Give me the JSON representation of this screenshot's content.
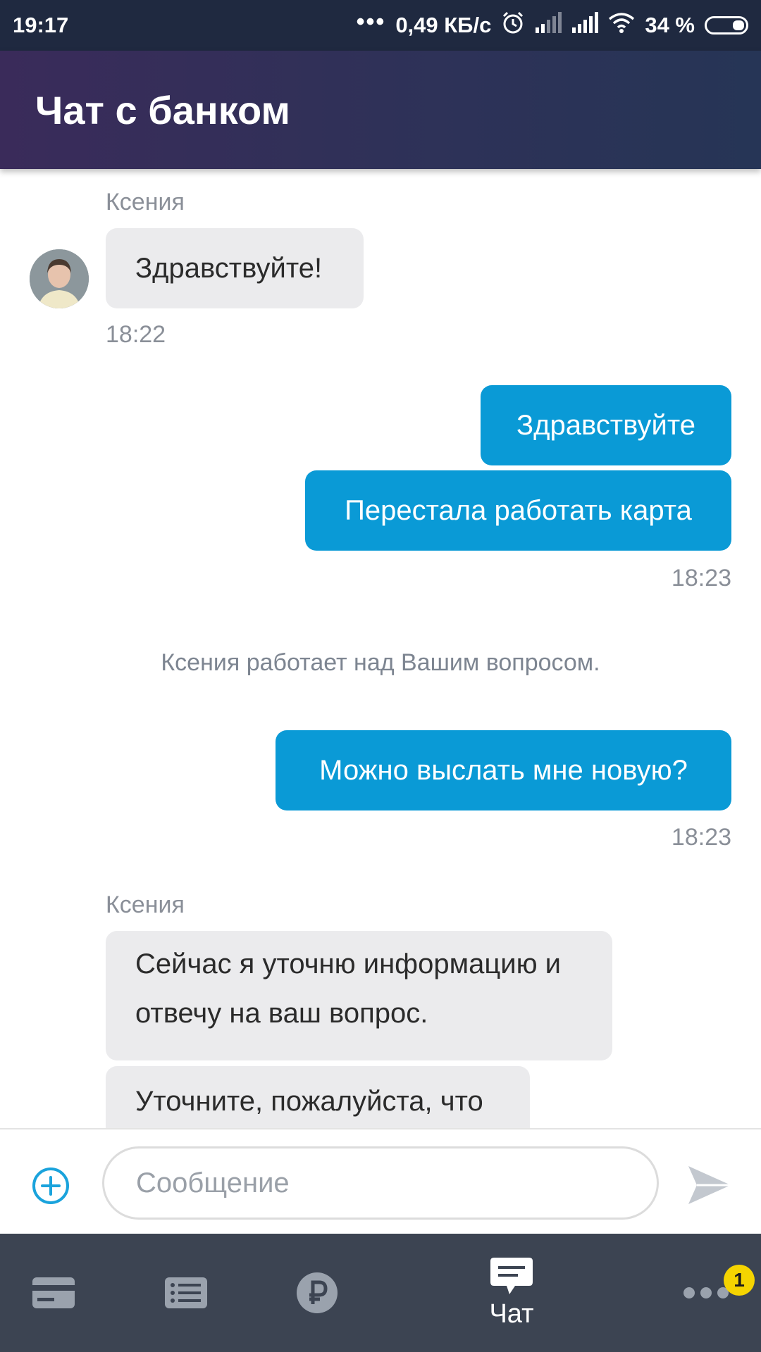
{
  "status_bar": {
    "time": "19:17",
    "dots": "•••",
    "network_speed": "0,49 КБ/с",
    "battery_percent": "34 %",
    "icons": [
      "alarm-icon",
      "signal-weak-icon",
      "signal-icon",
      "wifi-icon",
      "battery-icon"
    ]
  },
  "header": {
    "title": "Чат с банком"
  },
  "messages": [
    {
      "type": "incoming",
      "sender": "Ксения",
      "text": "Здравствуйте!",
      "time": "18:22"
    },
    {
      "type": "outgoing",
      "text": "Здравствуйте"
    },
    {
      "type": "outgoing",
      "text": "Перестала работать карта",
      "time": "18:23"
    },
    {
      "type": "system",
      "text": "Ксения работает над Вашим вопросом."
    },
    {
      "type": "outgoing",
      "text": "Можно выслать мне новую?",
      "time": "18:23"
    },
    {
      "type": "incoming",
      "sender": "Ксения",
      "lines": [
        "Сейчас я уточню информацию и",
        "отвечу на ваш вопрос."
      ]
    },
    {
      "type": "incoming",
      "text": "Уточните, пожалуйста, что"
    }
  ],
  "input": {
    "placeholder": "Сообщение"
  },
  "bottom_nav": {
    "items": [
      {
        "icon": "card-icon",
        "label": ""
      },
      {
        "icon": "list-icon",
        "label": ""
      },
      {
        "icon": "ruble-icon",
        "label": ""
      },
      {
        "icon": "chat-icon",
        "label": "Чат",
        "active": true
      },
      {
        "icon": "more-icon",
        "label": "",
        "badge": "1"
      }
    ]
  },
  "colors": {
    "status_bar": "#1f2940",
    "header_gradient": [
      "#3a2b5a",
      "#263556"
    ],
    "outgoing_bubble": "#0a9ad6",
    "incoming_bubble": "#ebebed",
    "nav_background": "#3c4452",
    "badge": "#f5d400",
    "accent": "#1aa3dc"
  }
}
